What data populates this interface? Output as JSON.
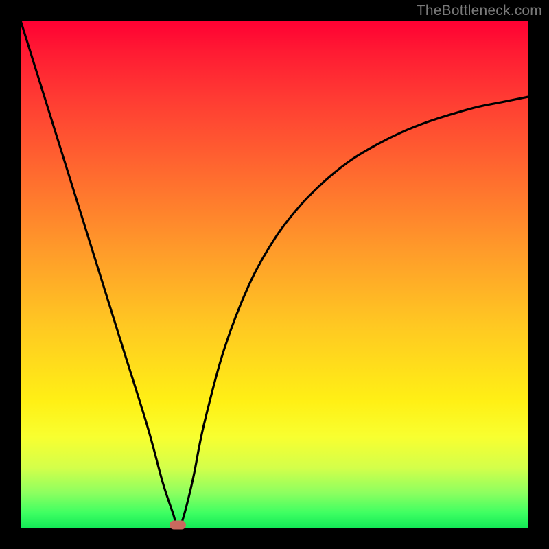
{
  "domain": "Chart",
  "watermark": "TheBottleneck.com",
  "colors": {
    "frame": "#000000",
    "curve": "#000000",
    "marker": "#c9695e",
    "gradient_stops": [
      "#ff0033",
      "#ff1a33",
      "#ff3a33",
      "#ff6a2f",
      "#ff9a2a",
      "#ffc822",
      "#fff015",
      "#f8ff30",
      "#d4ff4a",
      "#8dff60",
      "#3dff62",
      "#12e856"
    ],
    "watermark_text": "#7a7a7a"
  },
  "chart_data": {
    "type": "line",
    "title": "",
    "xlabel": "",
    "ylabel": "",
    "xlim": [
      0,
      100
    ],
    "ylim": [
      0,
      100
    ],
    "grid": false,
    "legend": false,
    "series": [
      {
        "name": "bottleneck-curve",
        "x": [
          0,
          5,
          10,
          15,
          20,
          25,
          28,
          30,
          31,
          32,
          34,
          36,
          40,
          45,
          50,
          55,
          60,
          65,
          70,
          75,
          80,
          85,
          90,
          95,
          100
        ],
        "y": [
          100,
          84,
          68,
          52,
          36,
          20,
          9,
          3,
          0,
          2,
          10,
          20,
          35,
          48,
          57,
          63.5,
          68.5,
          72.5,
          75.5,
          78,
          80,
          81.6,
          83,
          84,
          85
        ]
      }
    ],
    "annotations": [
      {
        "name": "optimum-marker",
        "x": 31,
        "y": 0
      }
    ],
    "notes": "X and Y values are relative coordinates in [0,100] along the inner plot area; no axis ticks or numeric labels are visible in the image, so values are positional estimates. The curve descends steeply from top-left to a zero-bottleneck minimum near x≈31, then rises with diminishing slope toward the right edge."
  }
}
